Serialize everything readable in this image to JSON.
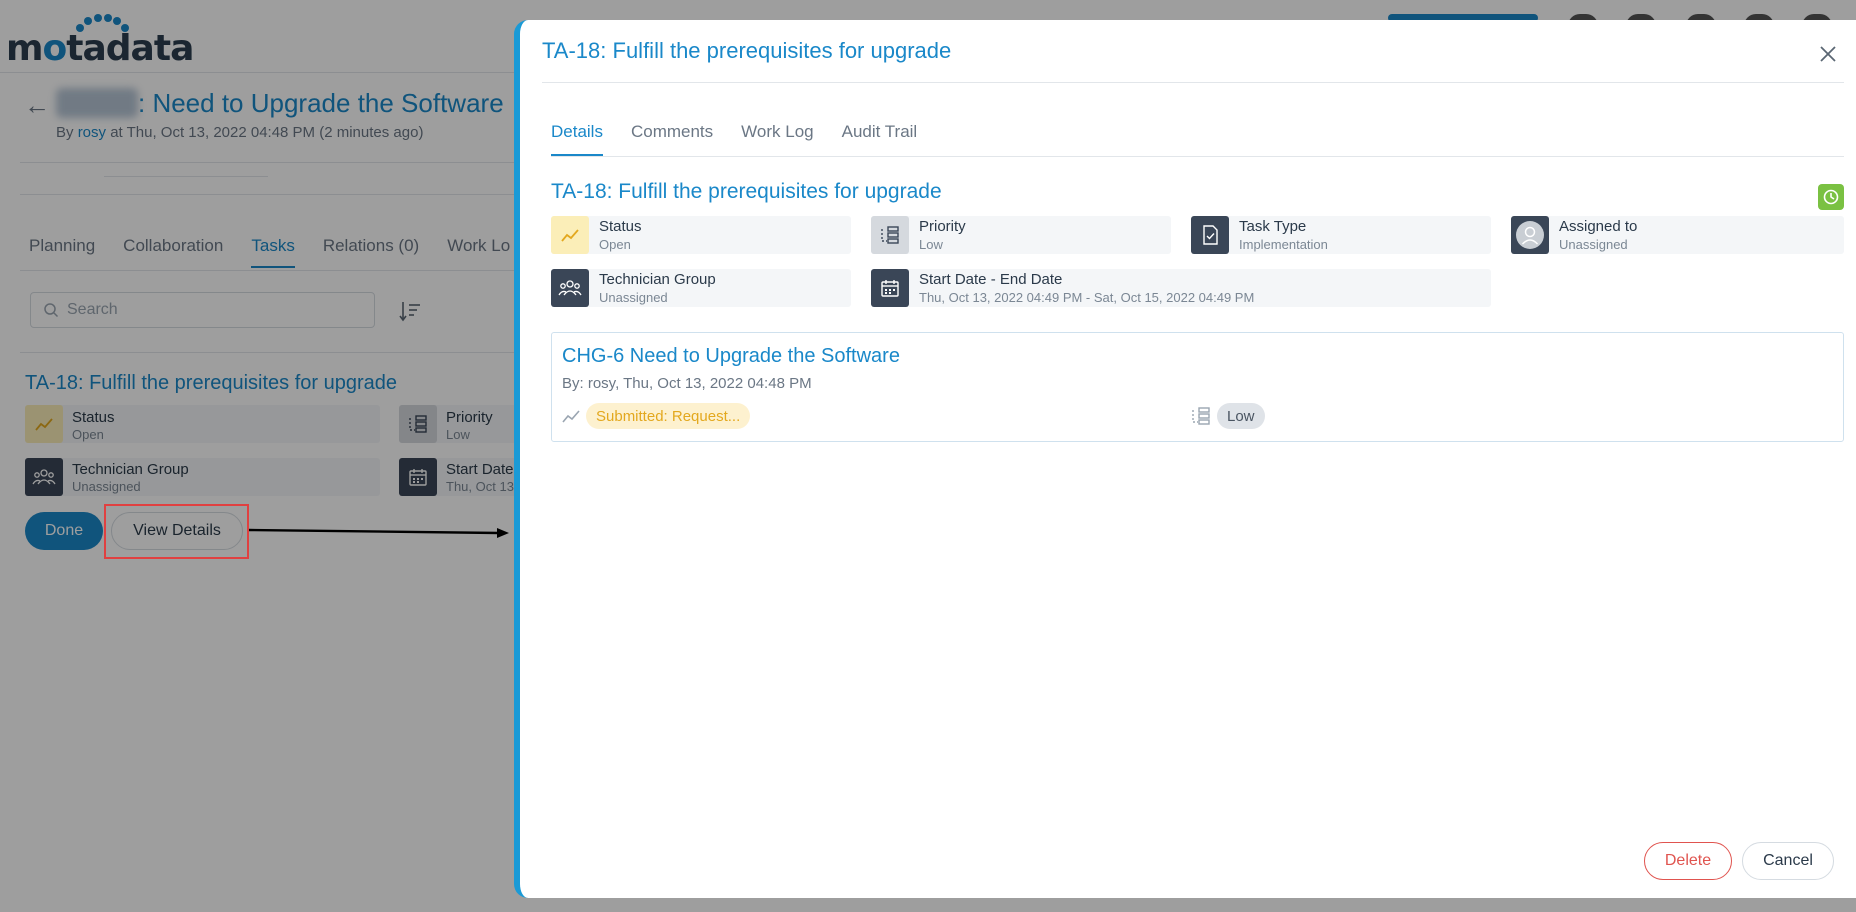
{
  "app": {
    "logo": "motadata"
  },
  "background": {
    "title": ": Need to Upgrade the Software",
    "byline_prefix": "By",
    "byline_user": "rosy",
    "byline_suffix": "at Thu, Oct 13, 2022 04:48 PM (2 minutes ago)",
    "tabs": [
      "Planning",
      "Collaboration",
      "Tasks",
      "Relations (0)",
      "Work Lo"
    ],
    "active_tab": "Tasks",
    "search_placeholder": "Search",
    "task_title": "TA-18: Fulfill the prerequisites for upgrade",
    "fields": {
      "status_label": "Status",
      "status_value": "Open",
      "priority_label": "Priority",
      "priority_value": "Low",
      "group_label": "Technician Group",
      "group_value": "Unassigned",
      "date_label": "Start Date",
      "date_value": "Thu, Oct 13"
    },
    "done_label": "Done",
    "view_details_label": "View Details"
  },
  "drawer": {
    "title": "TA-18: Fulfill the prerequisites for upgrade",
    "tabs": {
      "details": "Details",
      "comments": "Comments",
      "work_log": "Work Log",
      "audit_trail": "Audit Trail"
    },
    "active_tab": "Details",
    "task_title": "TA-18: Fulfill the prerequisites for upgrade",
    "fields": {
      "status_label": "Status",
      "status_value": "Open",
      "priority_label": "Priority",
      "priority_value": "Low",
      "task_type_label": "Task Type",
      "task_type_value": "Implementation",
      "assigned_label": "Assigned to",
      "assigned_value": "Unassigned",
      "group_label": "Technician Group",
      "group_value": "Unassigned",
      "date_label": "Start Date - End Date",
      "date_value": "Thu, Oct 13, 2022 04:49 PM - Sat, Oct 15, 2022 04:49 PM"
    },
    "reference": {
      "title": "CHG-6 Need to Upgrade the Software",
      "by": "By: rosy, Thu, Oct 13, 2022 04:48 PM",
      "status": "Submitted: Request...",
      "priority": "Low"
    },
    "delete_label": "Delete",
    "cancel_label": "Cancel"
  },
  "colors": {
    "accent": "#1a88c9",
    "status_yellow": "#e3a81e",
    "danger": "#e0544f",
    "success": "#7ac142"
  }
}
